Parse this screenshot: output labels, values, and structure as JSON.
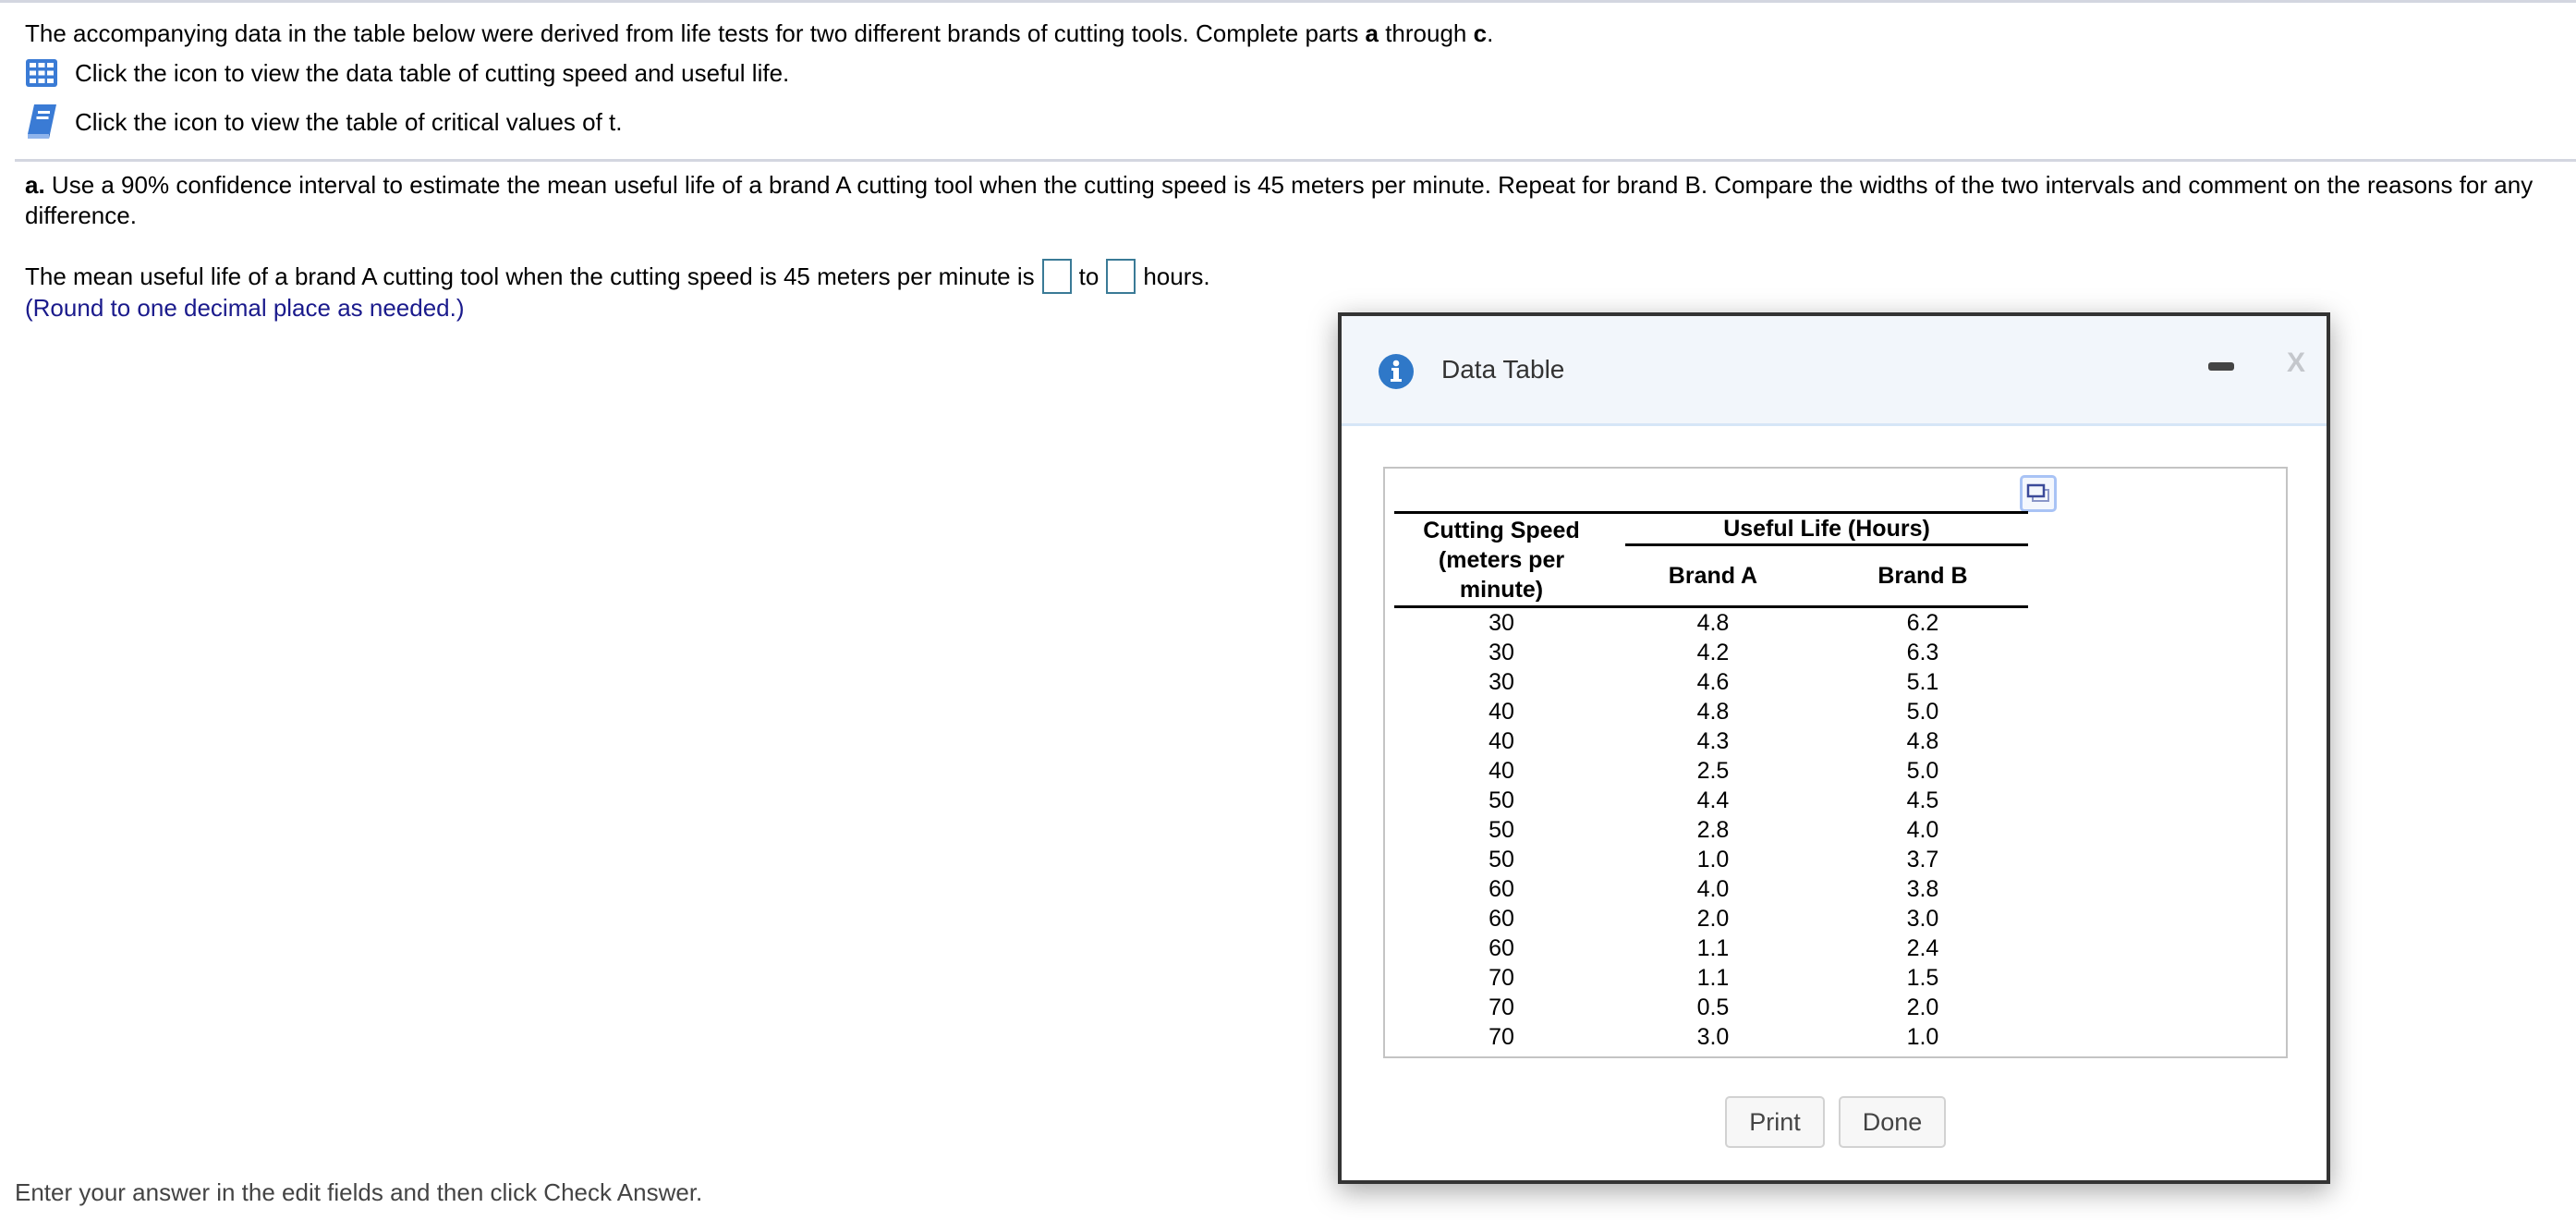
{
  "intro": {
    "text_prefix": "The accompanying data in the table below were derived from life tests for two different brands of cutting tools. Complete parts ",
    "bold_a": "a",
    "mid": " through ",
    "bold_c": "c",
    "suffix": "."
  },
  "links": [
    {
      "icon": "table-grid-icon",
      "label": "Click the icon to view the data table of cutting speed and useful life."
    },
    {
      "icon": "book-icon",
      "label": "Click the icon to view the table of critical values of t."
    }
  ],
  "part_a": {
    "label": "a.",
    "text": " Use a 90% confidence interval to estimate the mean useful life of a brand A cutting tool when the cutting speed is 45 meters per minute. Repeat for brand B. Compare the widths of the two intervals and comment on the reasons for any difference."
  },
  "answer": {
    "prefix": "The mean useful life of a brand A cutting tool when the cutting speed is 45 meters per minute is",
    "lower_value": "",
    "connector": "to",
    "upper_value": "",
    "suffix": "hours.",
    "hint": "(Round to one decimal place as needed.)"
  },
  "footer_note": "Enter your answer in the edit fields and then click Check Answer.",
  "dialog": {
    "title": "Data Table",
    "icon": "info-icon",
    "minimize_label": "minimize",
    "close_label": "X",
    "table": {
      "col1_header": [
        "Cutting Speed",
        "(meters per",
        "minute)"
      ],
      "group_header": "Useful Life (Hours)",
      "brand_a_header": "Brand A",
      "brand_b_header": "Brand B",
      "rows": [
        {
          "speed": "30",
          "a": "4.8",
          "b": "6.2"
        },
        {
          "speed": "30",
          "a": "4.2",
          "b": "6.3"
        },
        {
          "speed": "30",
          "a": "4.6",
          "b": "5.1"
        },
        {
          "speed": "40",
          "a": "4.8",
          "b": "5.0"
        },
        {
          "speed": "40",
          "a": "4.3",
          "b": "4.8"
        },
        {
          "speed": "40",
          "a": "2.5",
          "b": "5.0"
        },
        {
          "speed": "50",
          "a": "4.4",
          "b": "4.5"
        },
        {
          "speed": "50",
          "a": "2.8",
          "b": "4.0"
        },
        {
          "speed": "50",
          "a": "1.0",
          "b": "3.7"
        },
        {
          "speed": "60",
          "a": "4.0",
          "b": "3.8"
        },
        {
          "speed": "60",
          "a": "2.0",
          "b": "3.0"
        },
        {
          "speed": "60",
          "a": "1.1",
          "b": "2.4"
        },
        {
          "speed": "70",
          "a": "1.1",
          "b": "1.5"
        },
        {
          "speed": "70",
          "a": "0.5",
          "b": "2.0"
        },
        {
          "speed": "70",
          "a": "3.0",
          "b": "1.0"
        }
      ]
    },
    "print_label": "Print",
    "done_label": "Done"
  },
  "colors": {
    "icon_blue": "#3a7bd5",
    "input_border": "#3a7a96",
    "hint_navy": "#1a1a8c"
  }
}
